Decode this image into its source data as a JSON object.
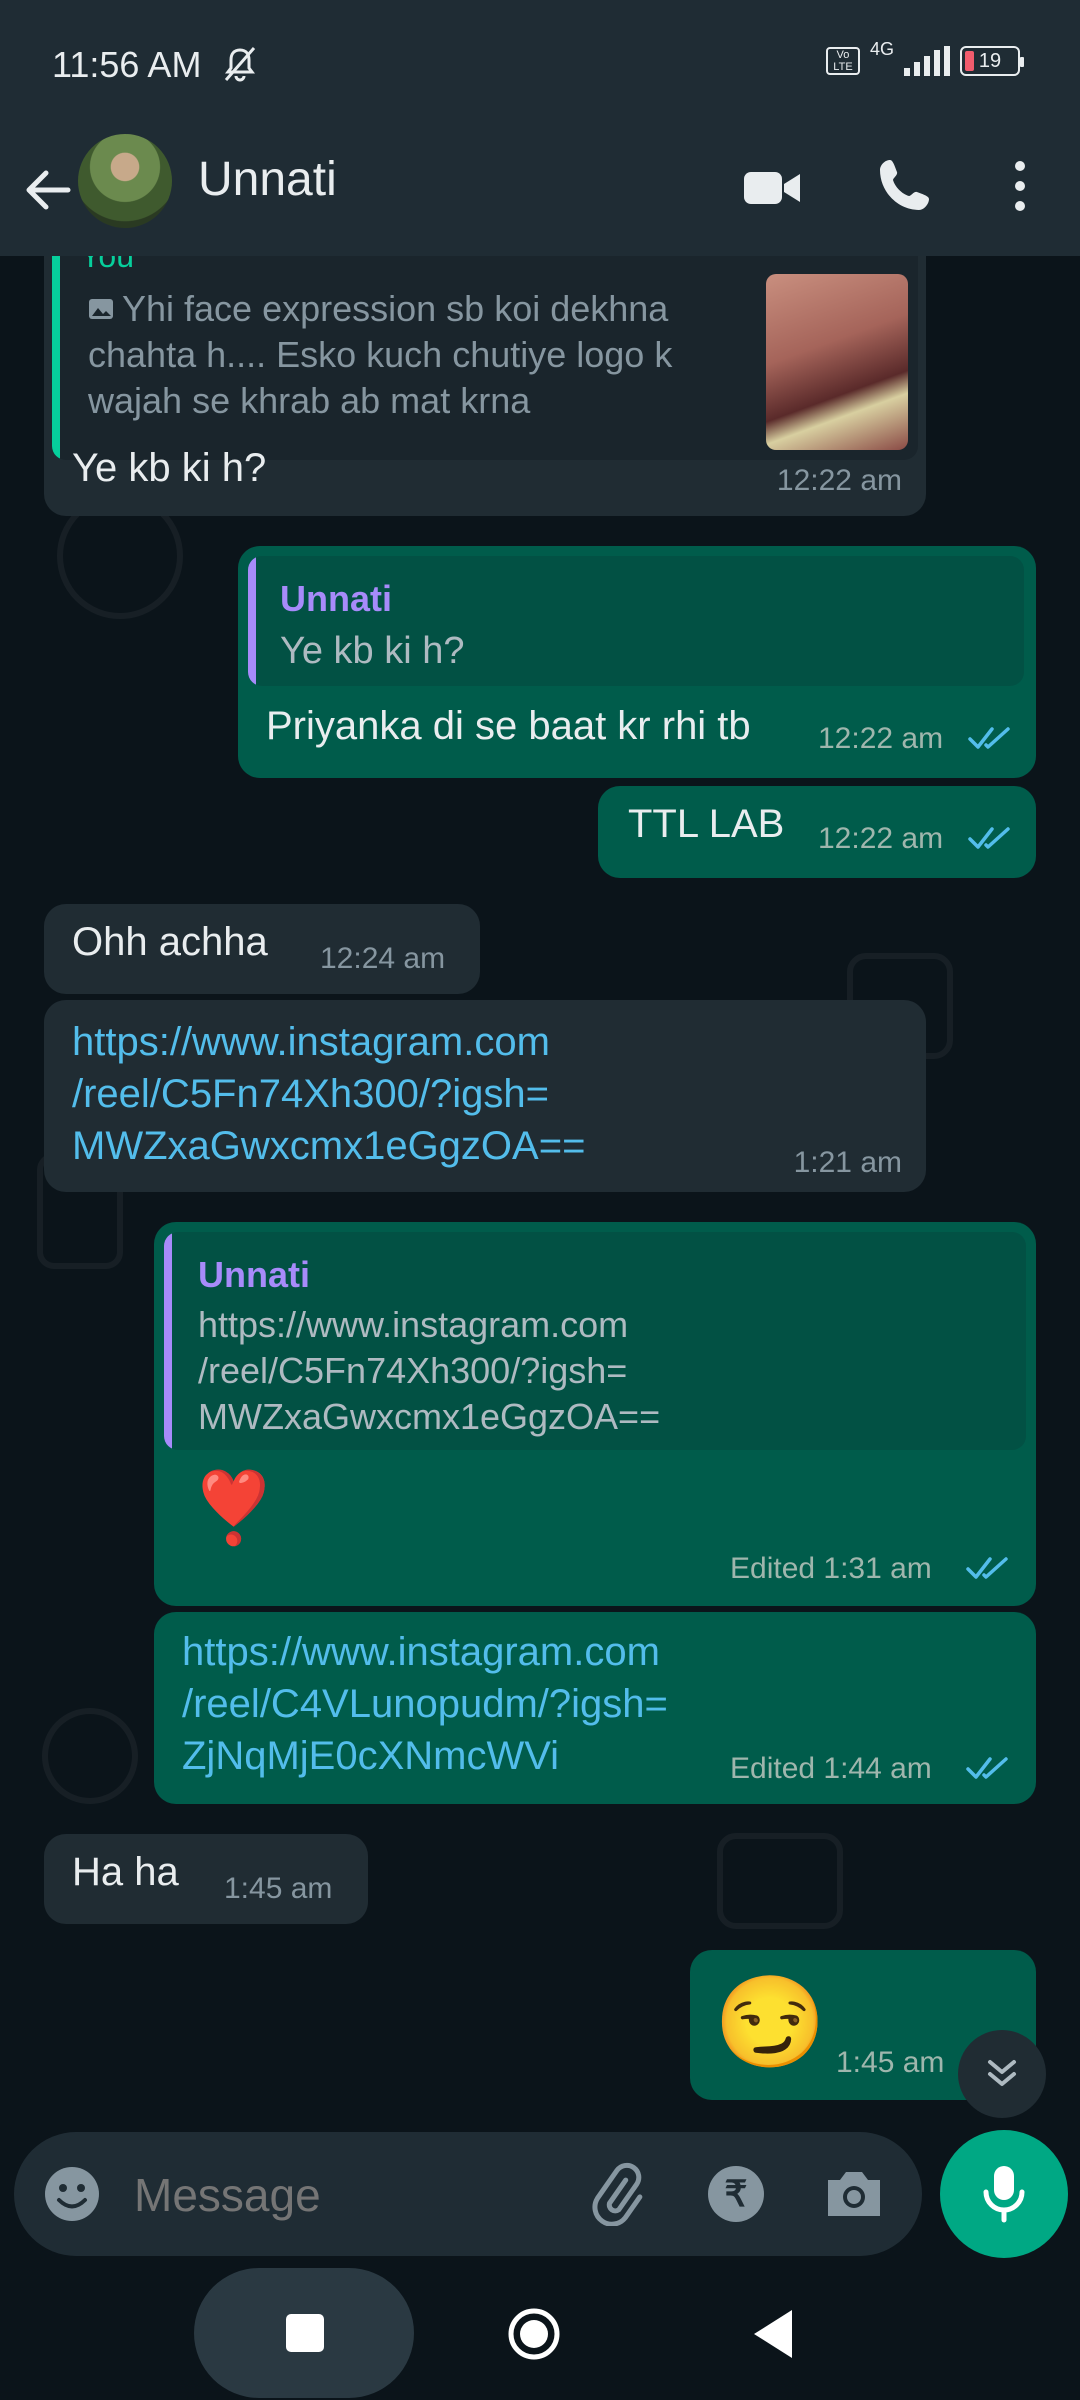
{
  "status_bar": {
    "time": "11:56 AM",
    "network": "4G",
    "volte": "Vo LTE",
    "battery": "19"
  },
  "header": {
    "contact_name": "Unnati"
  },
  "messages": [
    {
      "type": "in",
      "quote_sender": "You",
      "quote_text_lines": [
        "Yhi face expression sb koi dekhna",
        "chahta h.... Esko kuch chutiye logo k",
        "wajah se khrab ab mat krna"
      ],
      "text": "Ye kb ki h?",
      "time": "12:22 am"
    },
    {
      "type": "out",
      "quote_sender": "Unnati",
      "quote_text": "Ye kb ki h?",
      "text": "Priyanka di se baat kr rhi tb",
      "time": "12:22 am"
    },
    {
      "type": "out",
      "text": "TTL LAB",
      "time": "12:22 am"
    },
    {
      "type": "in",
      "text": "Ohh achha",
      "time": "12:24 am"
    },
    {
      "type": "in",
      "link_lines": [
        "https://www.instagram.com",
        "/reel/C5Fn74Xh300/?igsh=",
        "MWZxaGwxcmx1eGgzOA=="
      ],
      "time": "1:21 am"
    },
    {
      "type": "out",
      "quote_sender": "Unnati",
      "quote_text_lines": [
        "https://www.instagram.com",
        "/reel/C5Fn74Xh300/?igsh=",
        "MWZxaGwxcmx1eGgzOA=="
      ],
      "text": "❣️",
      "time": "Edited 1:31 am"
    },
    {
      "type": "out",
      "link_lines": [
        "https://www.instagram.com",
        "/reel/C4VLunopudm/?igsh=",
        "ZjNqMjE0cXNmcWVi"
      ],
      "time": "Edited 1:44 am"
    },
    {
      "type": "in",
      "text": "Ha ha",
      "time": "1:45 am"
    },
    {
      "type": "out",
      "text": "😏",
      "time": "1:45 am"
    }
  ],
  "composer": {
    "placeholder": "Message",
    "rupee": "₹"
  },
  "colors": {
    "incoming": "#202c33",
    "outgoing": "#005c4b",
    "accent": "#00a884",
    "link": "#53bdeb",
    "read_ticks": "#53bdeb",
    "quote_bar": "#a78bfa"
  }
}
